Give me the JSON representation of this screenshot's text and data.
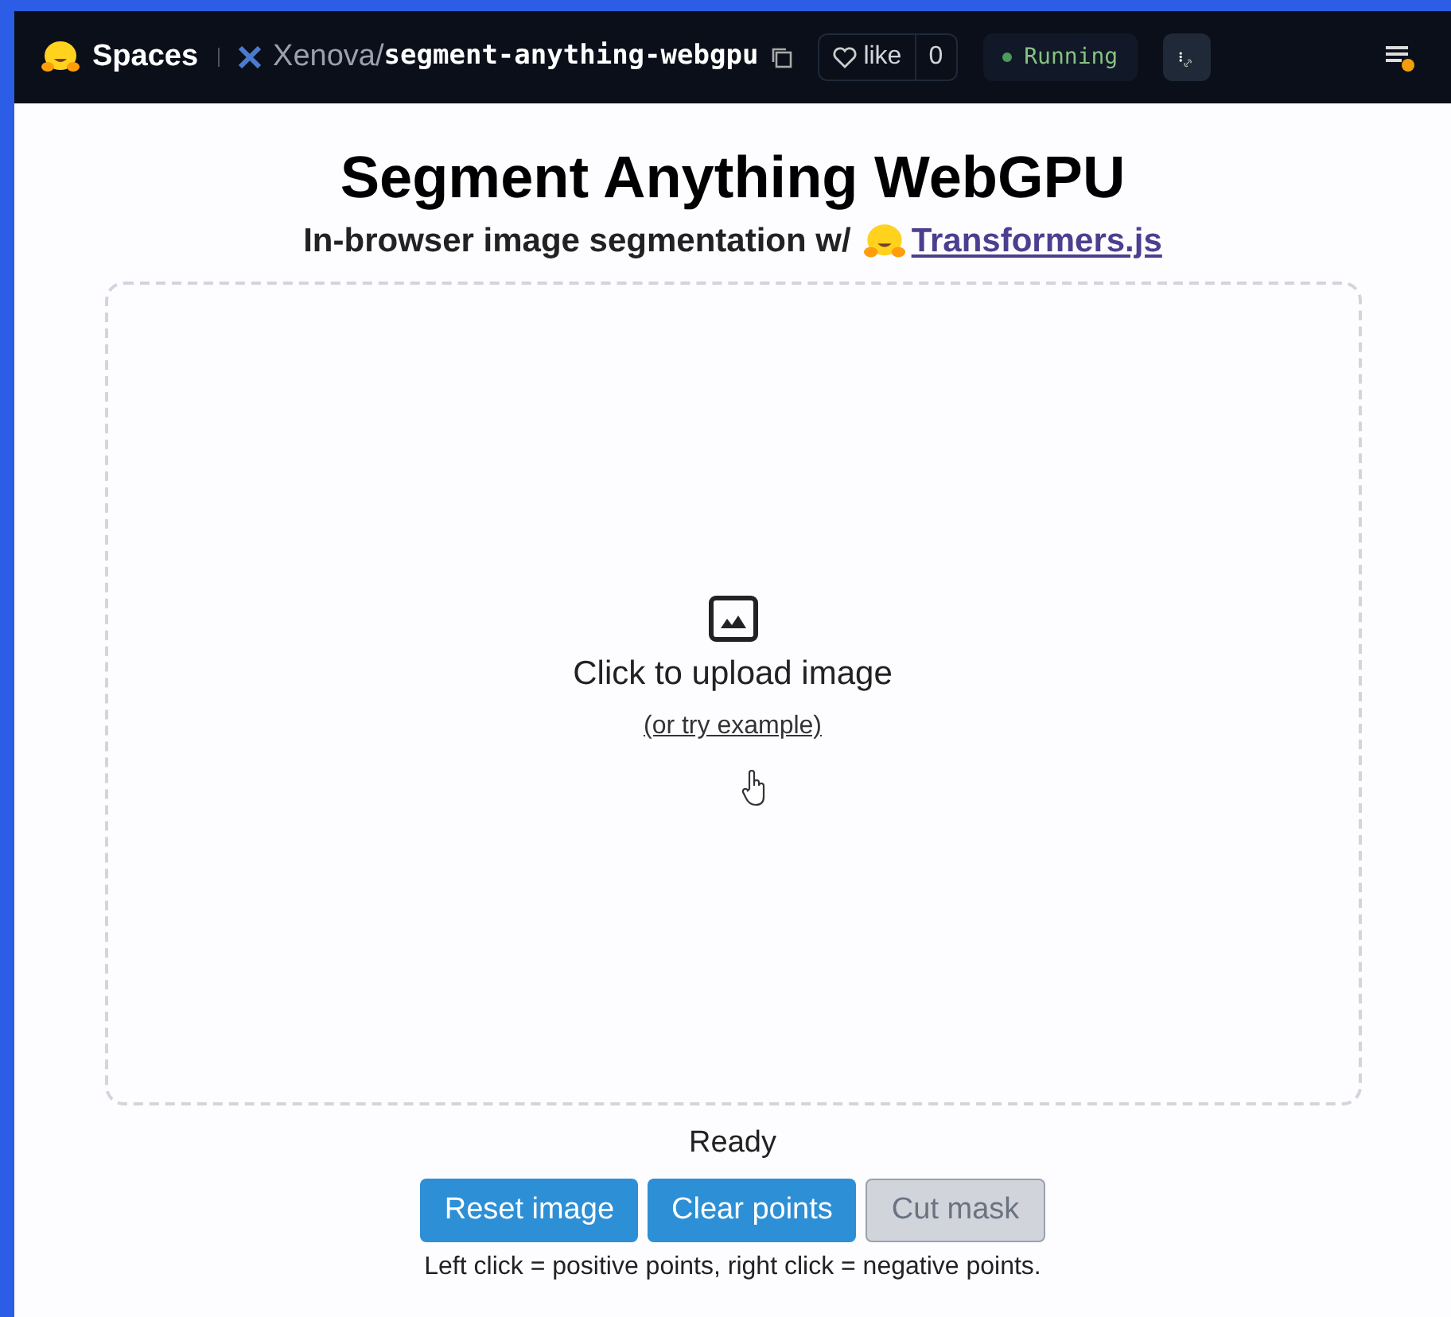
{
  "header": {
    "brand": "Spaces",
    "owner": "Xenova",
    "separator": "/",
    "repo": "segment-anything-webgpu",
    "like_label": "like",
    "like_count": "0",
    "status": "Running"
  },
  "title": "Segment Anything WebGPU",
  "subtitle": {
    "text": "In-browser image segmentation w/",
    "link": "Transformers.js"
  },
  "upload": {
    "label": "Click to upload image",
    "example_link": "(or try example)"
  },
  "status": "Ready",
  "buttons": [
    {
      "label": "Reset image",
      "disabled": false
    },
    {
      "label": "Clear points",
      "disabled": false
    },
    {
      "label": "Cut mask",
      "disabled": true
    }
  ],
  "hint": "Left click = positive points, right click = negative points."
}
